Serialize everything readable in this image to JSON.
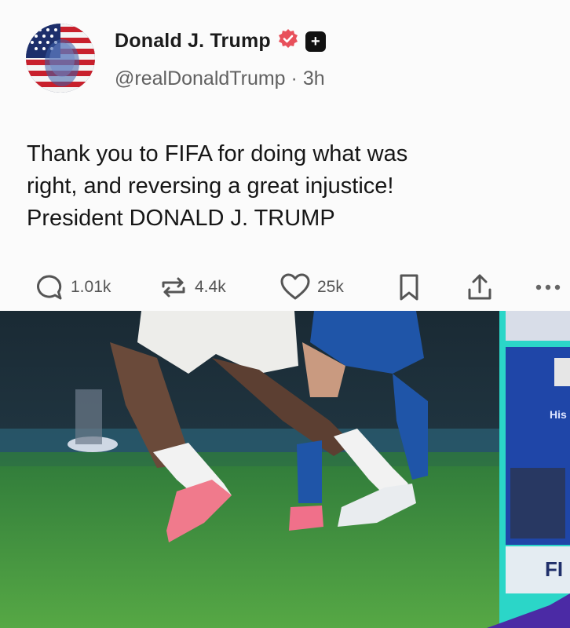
{
  "post": {
    "author_name": "Donald J. Trump",
    "handle": "@realDonaldTrump",
    "separator": "·",
    "time_ago": "3h",
    "text_lines": [
      "Thank you to FIFA for doing what was",
      "right, and reversing a great injustice!",
      "President DONALD J. TRUMP"
    ]
  },
  "actions": {
    "replies": "1.01k",
    "reposts": "4.4k",
    "likes": "25k"
  },
  "media": {
    "overlay_text_1": "His",
    "overlay_text_2": "FI"
  },
  "colors": {
    "verified": "#e8505b",
    "pitch": "#3a8a3e",
    "panel": "#2a4fb8",
    "border": "#2bd6c8"
  }
}
